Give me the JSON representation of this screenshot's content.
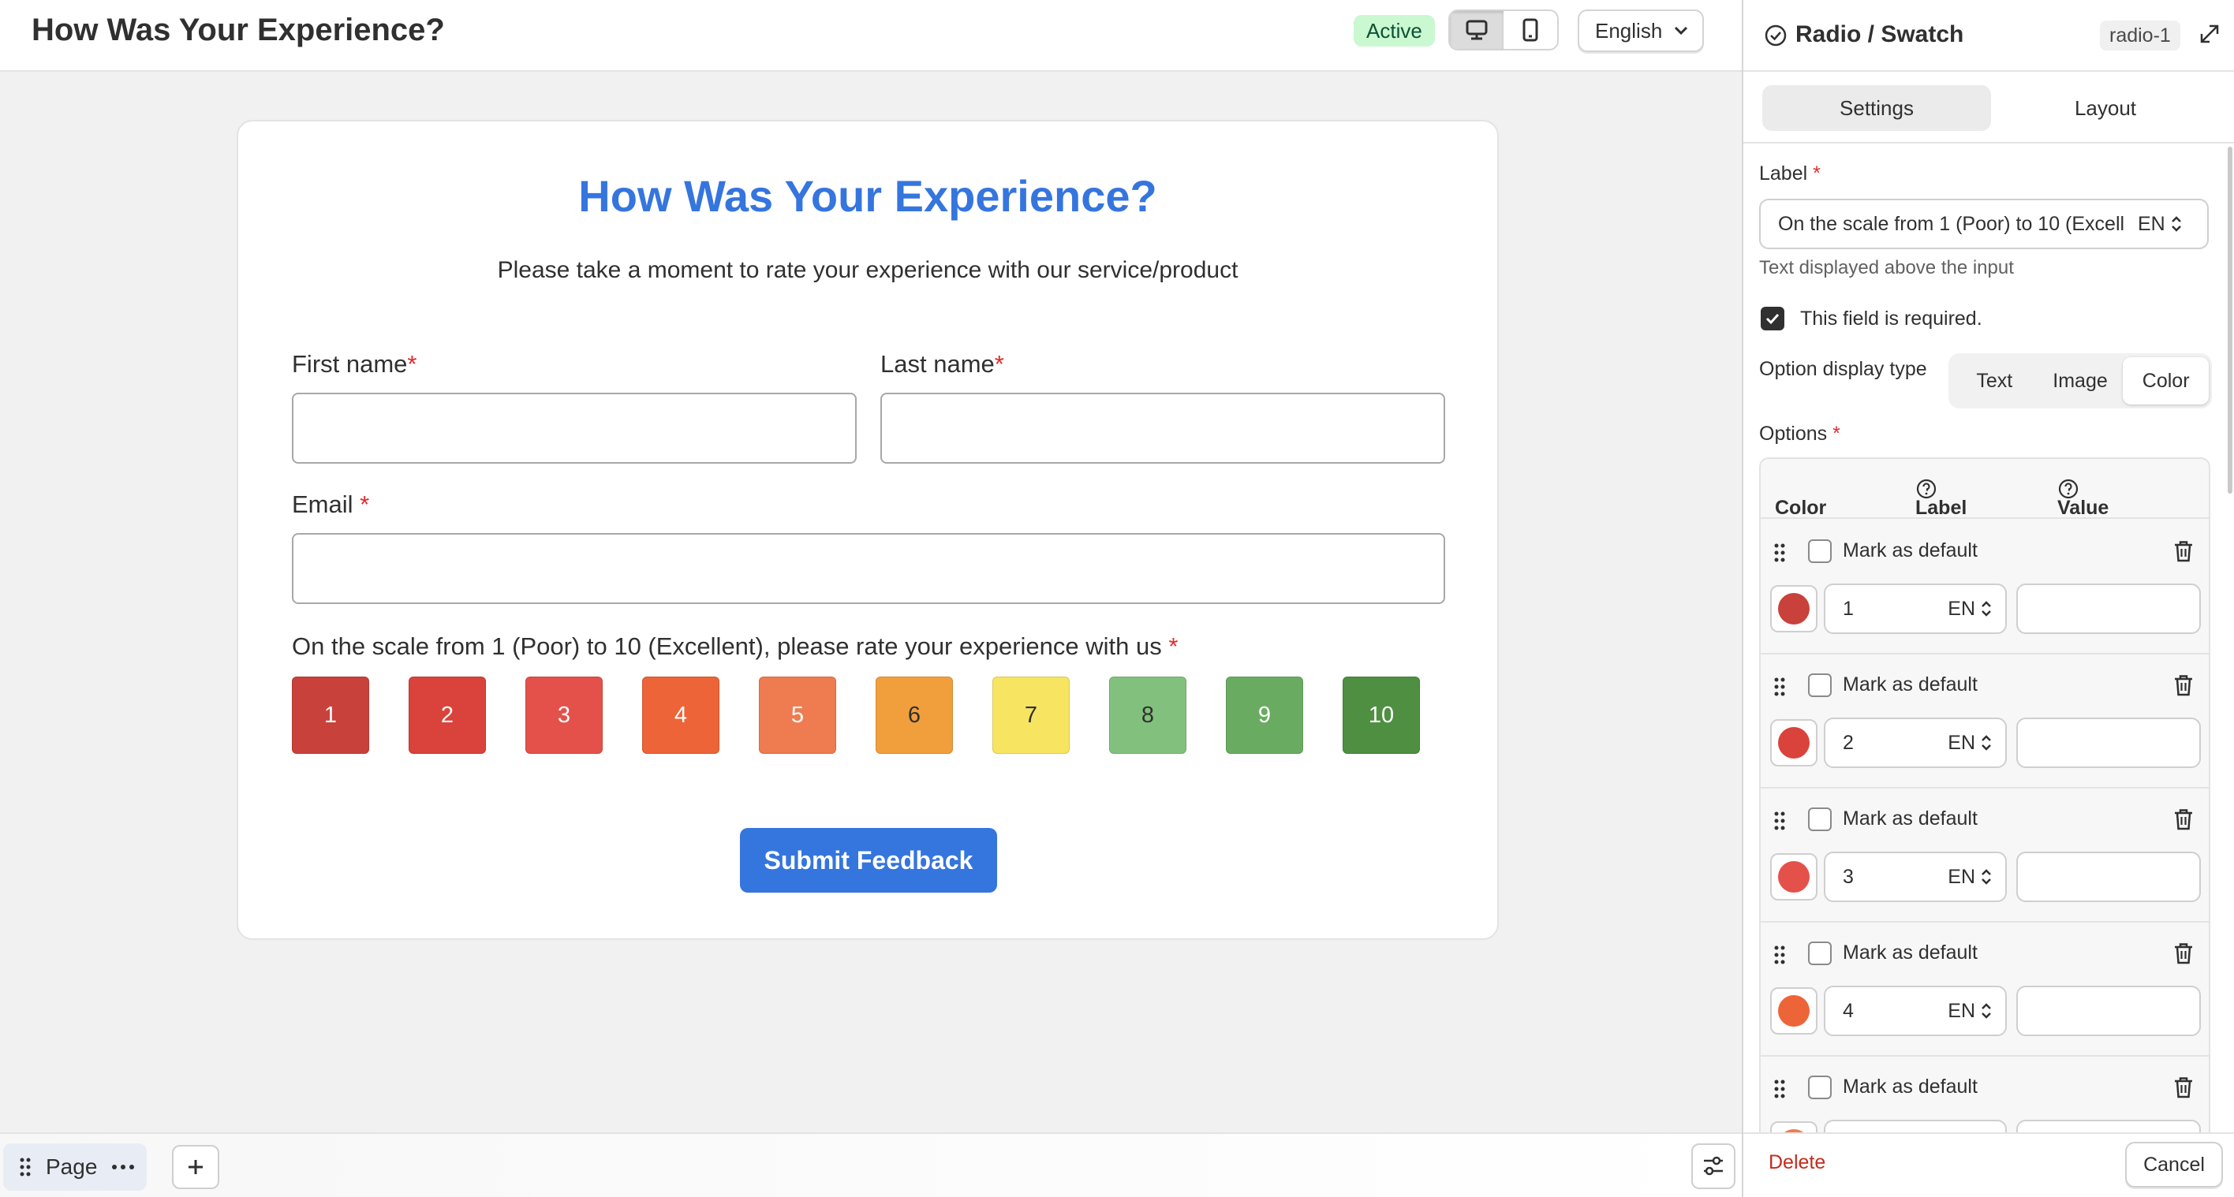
{
  "topbar": {
    "title": "How Was Your Experience?",
    "status": "Active",
    "language": "English"
  },
  "form": {
    "title": "How Was Your Experience?",
    "subtitle": "Please take a moment to rate your experience with our service/product",
    "first_name_label": "First name",
    "last_name_label": "Last name",
    "email_label": "Email ",
    "rating_label": "On the scale from 1 (Poor) to 10 (Excellent), please rate your experience with us ",
    "required_mark": "*",
    "swatches": [
      {
        "label": "1",
        "color": "#c9413b",
        "text_color": "#ffffff"
      },
      {
        "label": "2",
        "color": "#d9433b",
        "text_color": "#ffffff"
      },
      {
        "label": "3",
        "color": "#e4514a",
        "text_color": "#ffffff"
      },
      {
        "label": "4",
        "color": "#ed6438",
        "text_color": "#ffffff"
      },
      {
        "label": "5",
        "color": "#ef7b50",
        "text_color": "#ffffff"
      },
      {
        "label": "6",
        "color": "#f19f3c",
        "text_color": "#303030"
      },
      {
        "label": "7",
        "color": "#f7e562",
        "text_color": "#303030"
      },
      {
        "label": "8",
        "color": "#82c17d",
        "text_color": "#303030"
      },
      {
        "label": "9",
        "color": "#6aab62",
        "text_color": "#ffffff"
      },
      {
        "label": "10",
        "color": "#4e8f42",
        "text_color": "#ffffff"
      }
    ],
    "submit_label": "Submit Feedback"
  },
  "bottombar": {
    "page_label": "Page"
  },
  "panel": {
    "title": "Radio / Swatch",
    "element_id": "radio-1",
    "tabs": [
      "Settings",
      "Layout"
    ],
    "active_tab": "Settings",
    "label_field_label": "Label ",
    "label_value": "On the scale from 1 (Poor) to 10 (Excellent), please rate your experience with us",
    "label_lang": "EN",
    "label_help": "Text displayed above the input",
    "required_checkbox_label": "This field is required.",
    "required_checked": true,
    "display_type_label": "Option display type",
    "display_types": [
      "Text",
      "Image",
      "Color"
    ],
    "active_display_type": "Color",
    "options_label": "Options ",
    "options_columns": {
      "color": "Color",
      "label": "Label",
      "value": "Value"
    },
    "mark_default_label": "Mark as default",
    "options": [
      {
        "label": "1",
        "lang": "EN",
        "value": "",
        "color": "#c9413b"
      },
      {
        "label": "2",
        "lang": "EN",
        "value": "",
        "color": "#d9433b"
      },
      {
        "label": "3",
        "lang": "EN",
        "value": "",
        "color": "#e4514a"
      },
      {
        "label": "4",
        "lang": "EN",
        "value": "",
        "color": "#ed6438"
      },
      {
        "label": "",
        "lang": "",
        "value": "",
        "color": "#ef7b50"
      }
    ],
    "delete_label": "Delete",
    "cancel_label": "Cancel"
  },
  "colors": {
    "accent": "#3575de",
    "required": "#e22b2b",
    "active_badge_bg": "#c9f8d1"
  }
}
